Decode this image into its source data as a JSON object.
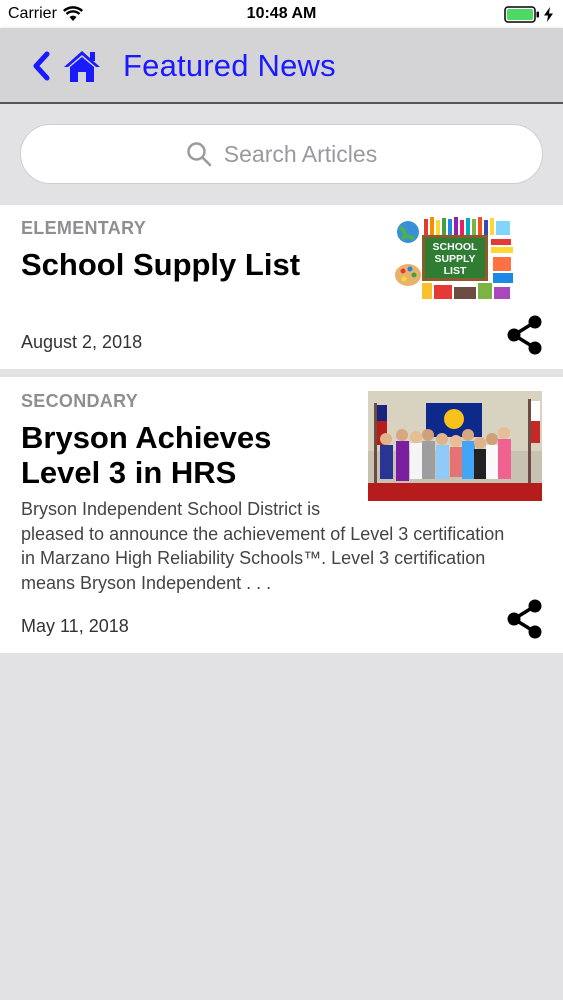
{
  "status_bar": {
    "carrier": "Carrier",
    "time": "10:48 AM"
  },
  "nav": {
    "title": "Featured News",
    "back_icon": "chevron-left-icon",
    "home_icon": "home-icon",
    "accent": "#1a1aff"
  },
  "search": {
    "placeholder": "Search Articles"
  },
  "articles": [
    {
      "category": "ELEMENTARY",
      "title": "School Supply List",
      "date": "August 2, 2018",
      "thumb_text": [
        "SCHOOL",
        "SUPPLY",
        "LIST"
      ]
    },
    {
      "category": "SECONDARY",
      "title_line1": "Bryson Achieves",
      "title_line2": "Level 3 in HRS",
      "summary_lines": [
        "Bryson Independent School District is",
        "pleased to announce the achievement of Level 3 certification",
        "in Marzano High Reliability Schools™. Level 3 certification",
        "means Bryson Independent . . ."
      ],
      "date": "May 11, 2018"
    }
  ]
}
